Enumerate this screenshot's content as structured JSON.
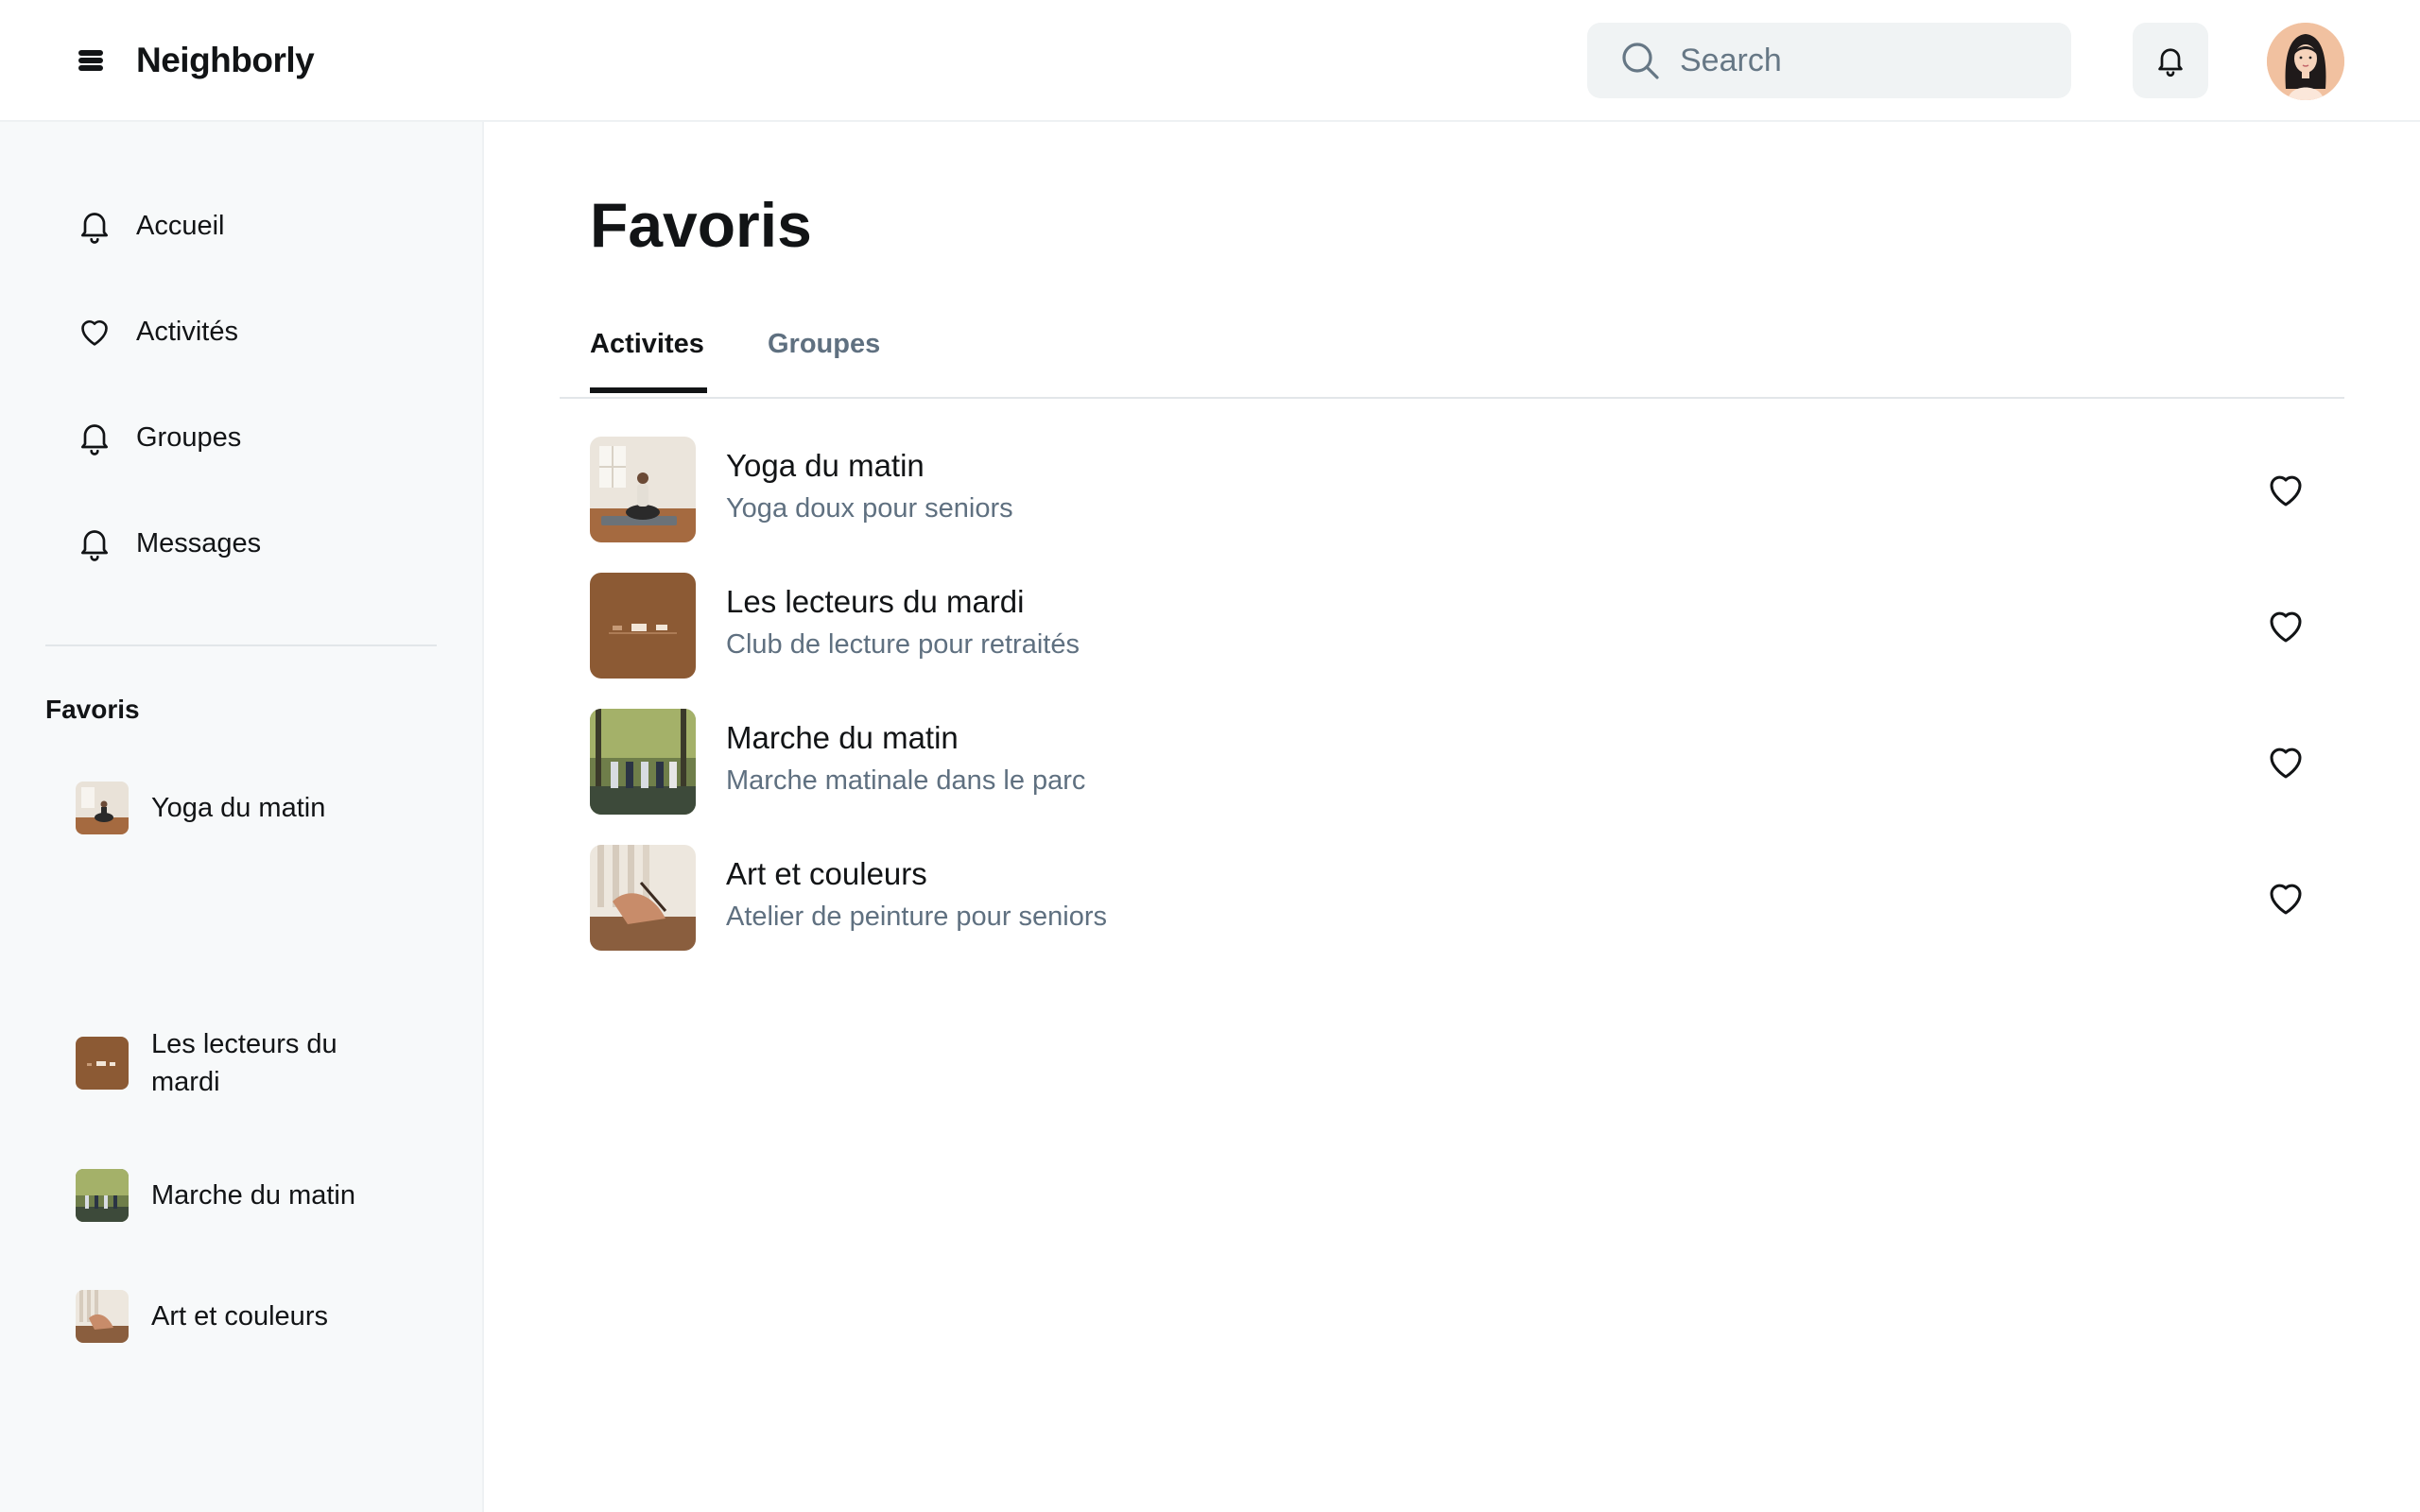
{
  "header": {
    "brand_name": "Neighborly",
    "search_placeholder": "Search"
  },
  "sidebar": {
    "nav": [
      {
        "label": "Accueil",
        "icon": "bell-icon"
      },
      {
        "label": "Activités",
        "icon": "heart-icon"
      },
      {
        "label": "Groupes",
        "icon": "bell-icon"
      },
      {
        "label": "Messages",
        "icon": "bell-icon"
      }
    ],
    "favorites_heading": "Favoris",
    "favorites": [
      {
        "label": "Yoga du matin"
      },
      {
        "label": "Les lecteurs du mardi"
      },
      {
        "label": "Marche du matin"
      },
      {
        "label": "Art et couleurs"
      }
    ]
  },
  "main": {
    "title": "Favoris",
    "tabs": [
      {
        "label": "Activites",
        "active": true
      },
      {
        "label": "Groupes",
        "active": false
      }
    ],
    "activities": [
      {
        "title": "Yoga du matin",
        "subtitle": "Yoga doux pour seniors"
      },
      {
        "title": "Les lecteurs du mardi",
        "subtitle": "Club de lecture pour retraités"
      },
      {
        "title": "Marche du matin",
        "subtitle": "Marche matinale dans le parc"
      },
      {
        "title": "Art et couleurs",
        "subtitle": "Atelier de peinture pour seniors"
      }
    ]
  },
  "colors": {
    "text_primary": "#121416",
    "text_secondary": "#5f7080",
    "surface": "#f0f3f4",
    "sidebar_bg": "#f7f9fa",
    "thumb_brown": "#8c5a34"
  }
}
